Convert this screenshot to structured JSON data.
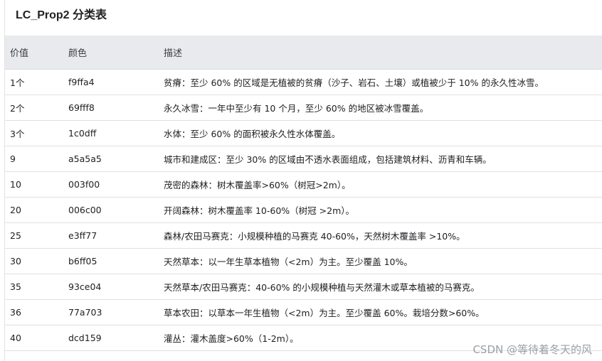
{
  "title": "LC_Prop2 分类表",
  "columns": [
    "价值",
    "颜色",
    "描述"
  ],
  "rows": [
    {
      "value": "1个",
      "color": "f9ffa4",
      "desc": "贫瘠：至少 60% 的区域是无植被的贫瘠（沙子、岩石、土壤）或植被少于 10% 的永久性冰雪。"
    },
    {
      "value": "2个",
      "color": "69fff8",
      "desc": "永久冰雪：一年中至少有 10 个月，至少 60% 的地区被冰雪覆盖。"
    },
    {
      "value": "3个",
      "color": "1c0dff",
      "desc": "水体：至少 60% 的面积被永久性水体覆盖。"
    },
    {
      "value": "9",
      "color": "a5a5a5",
      "desc": "城市和建成区：至少 30% 的区域由不透水表面组成，包括建筑材料、沥青和车辆。"
    },
    {
      "value": "10",
      "color": "003f00",
      "desc": "茂密的森林：树木覆盖率>60%（树冠>2m）。"
    },
    {
      "value": "20",
      "color": "006c00",
      "desc": "开阔森林：树木覆盖率 10-60%（树冠 >2m）。"
    },
    {
      "value": "25",
      "color": "e3ff77",
      "desc": "森林/农田马赛克：小规模种植的马赛克 40-60%，天然树木覆盖率 >10%。"
    },
    {
      "value": "30",
      "color": "b6ff05",
      "desc": "天然草本：以一年生草本植物（<2m）为主。至少覆盖 10%。"
    },
    {
      "value": "35",
      "color": "93ce04",
      "desc": "天然草本/农田马赛克：40-60% 的小规模种植与天然灌木或草本植被的马赛克。"
    },
    {
      "value": "36",
      "color": "77a703",
      "desc": "草本农田：以草本一年生植物（<2m）为主。至少覆盖 60%。栽培分数>60%。"
    },
    {
      "value": "40",
      "color": "dcd159",
      "desc": "灌丛：灌木盖度>60%（1-2m）。"
    }
  ],
  "watermark": "CSDN @等待着冬天的风"
}
